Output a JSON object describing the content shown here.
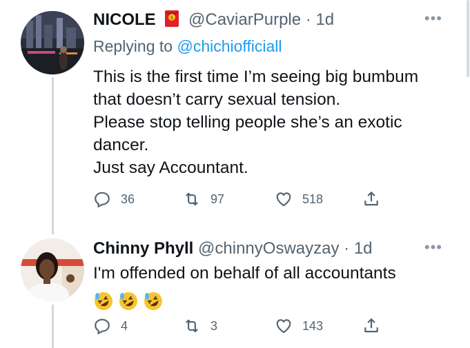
{
  "tweets": [
    {
      "name": "NICOLE",
      "badge_icon": "red-envelope-icon",
      "handle": "@CaviarPurple",
      "separator": "·",
      "time": "1d",
      "reply_prefix": "Replying to",
      "reply_handle": "@chichiofficiall",
      "lines": [
        "This is the first time I’m seeing big bumbum",
        "that doesn’t carry sexual tension.",
        "Please stop telling people she’s an exotic",
        "dancer.",
        "Just say Accountant."
      ],
      "replies": "36",
      "retweets": "97",
      "likes": "518"
    },
    {
      "name": "Chinny Phyll",
      "handle": "@chinnyOswayzay",
      "separator": "·",
      "time": "1d",
      "lines": [
        "I'm offended on behalf of all accountants"
      ],
      "emojis": [
        "rolling-laughing-emoji",
        "rolling-laughing-emoji",
        "rolling-laughing-emoji"
      ],
      "replies": "4",
      "retweets": "3",
      "likes": "143"
    }
  ],
  "colors": {
    "link": "#1d9bf0",
    "muted": "#536471",
    "line": "#cfd9de"
  }
}
